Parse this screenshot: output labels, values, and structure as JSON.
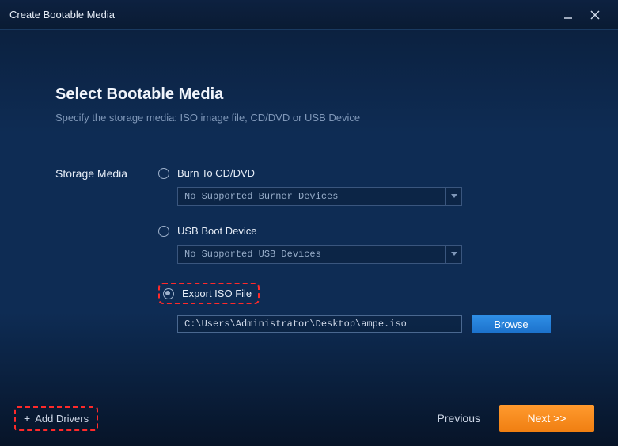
{
  "window": {
    "title": "Create Bootable Media"
  },
  "header": {
    "heading": "Select Bootable Media",
    "subtitle": "Specify the storage media: ISO image file, CD/DVD or USB Device"
  },
  "section_label": "Storage Media",
  "options": {
    "cd": {
      "label": "Burn To CD/DVD",
      "combo": "No Supported Burner Devices"
    },
    "usb": {
      "label": "USB Boot Device",
      "combo": "No Supported USB Devices"
    },
    "iso": {
      "label": "Export ISO File",
      "path": "C:\\Users\\Administrator\\Desktop\\ampe.iso",
      "browse": "Browse"
    }
  },
  "footer": {
    "add_drivers": "Add Drivers",
    "previous": "Previous",
    "next": "Next  >>"
  }
}
